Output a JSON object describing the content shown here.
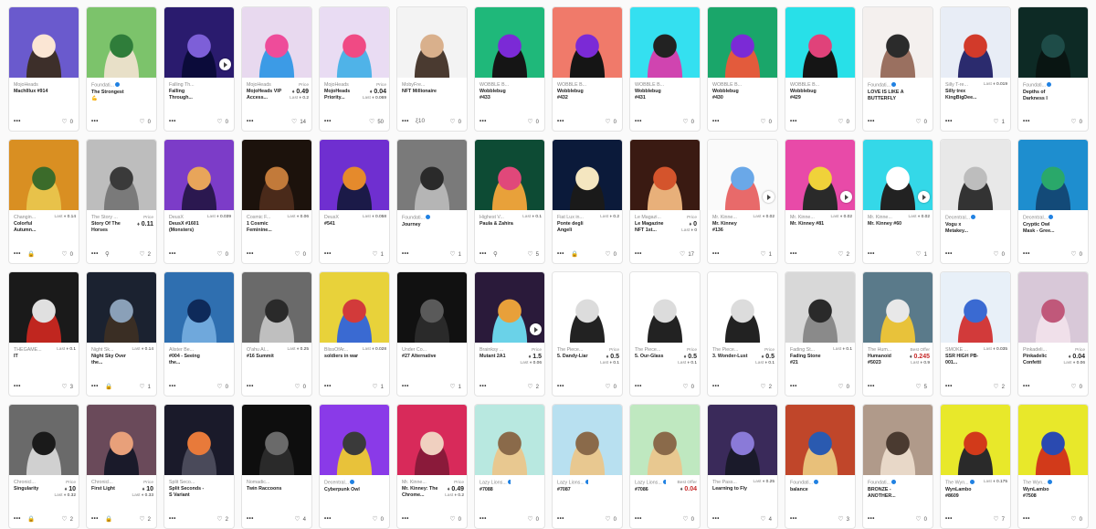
{
  "cards": [
    {
      "collection": "MojoHeads",
      "verified": false,
      "name": "MachIllux #914",
      "likes": "0",
      "footer_icon": "",
      "art": [
        "#6a5acd",
        "#fbe6d4",
        "#3d2f2a"
      ]
    },
    {
      "collection": "Foundati...",
      "verified": true,
      "name": "The Strongest 💪",
      "likes": "0",
      "footer_icon": "",
      "art": [
        "#7cc36b",
        "#2f7d3a",
        "#e8e0c8"
      ]
    },
    {
      "collection": "Falling Th...",
      "verified": false,
      "name": "Falling Through...",
      "likes": "0",
      "footer_icon": "",
      "play": true,
      "art": [
        "#2a1b6e",
        "#7d5fd8",
        "#0b0b3a"
      ]
    },
    {
      "collection": "MojoHeads",
      "verified": false,
      "name": "MojoHeads VIP Access...",
      "price_label": "Price",
      "price": "0.49",
      "last": "0.2",
      "likes": "14",
      "footer_icon": "",
      "art": [
        "#e8d9ef",
        "#ee4c9a",
        "#3c9be6"
      ]
    },
    {
      "collection": "MojoHeads",
      "verified": false,
      "name": "MojoHeads Priority...",
      "price_label": "Price",
      "price": "0.04",
      "last": "0.069",
      "likes": "50",
      "footer_icon": "",
      "art": [
        "#e9dcf3",
        "#f04a84",
        "#4fb3e8"
      ]
    },
    {
      "collection": "MobyFre...",
      "verified": false,
      "name": "NFT Millionaire",
      "likes": "0",
      "footer_icon": "ξ10",
      "art": [
        "#f3f3f3",
        "#d9b08c",
        "#4a3a30"
      ]
    },
    {
      "collection": "WOBBLE B...",
      "verified": false,
      "name": "Wobblebug #433",
      "likes": "0",
      "footer_icon": "",
      "art": [
        "#1fb87a",
        "#7b2ad6",
        "#151515"
      ]
    },
    {
      "collection": "WOBBLE B...",
      "verified": false,
      "name": "Wobblebug #432",
      "likes": "0",
      "footer_icon": "",
      "art": [
        "#f07a6a",
        "#7b2ad6",
        "#151515"
      ]
    },
    {
      "collection": "WOBBLE B...",
      "verified": false,
      "name": "Wobblebug #431",
      "likes": "0",
      "footer_icon": "",
      "art": [
        "#34e0f0",
        "#222222",
        "#d044b0"
      ]
    },
    {
      "collection": "WOBBLE B...",
      "verified": false,
      "name": "Wobblebug #430",
      "likes": "0",
      "footer_icon": "",
      "art": [
        "#1aa66a",
        "#7b2ad6",
        "#e35b3c"
      ]
    },
    {
      "collection": "WOBBLE B...",
      "verified": false,
      "name": "Wobblebug #429",
      "likes": "0",
      "footer_icon": "",
      "art": [
        "#28e0e8",
        "#e0427a",
        "#151515"
      ]
    },
    {
      "collection": "Foundati...",
      "verified": true,
      "name": "LOVE IS LIKE A BUTTERFLY",
      "likes": "0",
      "footer_icon": "",
      "art": [
        "#f4f0ee",
        "#2b2b2b",
        "#9a7060"
      ]
    },
    {
      "collection": "Silly T-re...",
      "verified": false,
      "name": "Silly trex KingBigDee...",
      "last": "0.019",
      "likes": "1",
      "footer_icon": "",
      "art": [
        "#e8edf6",
        "#d23a2a",
        "#2b2b6e"
      ]
    },
    {
      "collection": "Foundati...",
      "verified": true,
      "name": "Depths of Darkness I",
      "likes": "0",
      "footer_icon": "",
      "art": [
        "#0d2a25",
        "#1e4c48",
        "#091512"
      ]
    },
    {
      "collection": "Changin...",
      "verified": false,
      "name": "Colorful Autumn...",
      "last": "0.14",
      "likes": "0",
      "footer_icon": "🔒",
      "art": [
        "#d98f22",
        "#3b6b2a",
        "#e8c24a"
      ]
    },
    {
      "collection": "The Story ...",
      "verified": false,
      "name": "Story Of The Horses",
      "price_label": "Price",
      "price": "0.11",
      "likes": "2",
      "footer_icon": "⚲",
      "art": [
        "#bdbdbd",
        "#3a3a3a",
        "#7a7a7a"
      ]
    },
    {
      "collection": "DeusX",
      "verified": false,
      "name": "DeusX #1601 (Monsters)",
      "last": "0.039",
      "likes": "0",
      "footer_icon": "",
      "art": [
        "#7c3cc8",
        "#e8a55a",
        "#2b1850"
      ]
    },
    {
      "collection": "Cosmic F...",
      "verified": false,
      "name": "1 Cosmic Feminine...",
      "last": "0.06",
      "likes": "0",
      "footer_icon": "",
      "art": [
        "#1c120c",
        "#c27a3a",
        "#4a2a1a"
      ]
    },
    {
      "collection": "DeusX",
      "verified": false,
      "name": "#541",
      "last": "0.058",
      "likes": "1",
      "footer_icon": "",
      "art": [
        "#6f2fd0",
        "#e58a2c",
        "#1b1a48"
      ]
    },
    {
      "collection": "Foundati...",
      "verified": true,
      "name": "Journey",
      "likes": "1",
      "footer_icon": "",
      "art": [
        "#7a7a7a",
        "#2a2a2a",
        "#b5b5b5"
      ]
    },
    {
      "collection": "Highest V...",
      "verified": false,
      "name": "Paula & Zahira",
      "last": "0.1",
      "likes": "5",
      "footer_icon": "⚲",
      "art": [
        "#0d4b34",
        "#e0487a",
        "#e8a13a"
      ]
    },
    {
      "collection": "Fiat Lux in...",
      "verified": false,
      "name": "Ponte degli Angeli",
      "last": "0.2",
      "likes": "0",
      "footer_icon": "🔒",
      "art": [
        "#0b1a3a",
        "#f4e6c0",
        "#1a1a1a"
      ]
    },
    {
      "collection": "Le Magazi...",
      "verified": false,
      "name": "Le Magazine NFT 1st...",
      "price_label": "Price",
      "price": "0",
      "last": "0",
      "likes": "17",
      "footer_icon": "",
      "art": [
        "#3a1a12",
        "#d4542c",
        "#e8b07a"
      ]
    },
    {
      "collection": "Mr. Kinne...",
      "verified": false,
      "name": "Mr. Kinney #136",
      "last": "0.02",
      "likes": "1",
      "footer_icon": "",
      "play": true,
      "art": [
        "#fafafa",
        "#6aa8e8",
        "#e86a6a"
      ]
    },
    {
      "collection": "Mr. Kinne...",
      "verified": false,
      "name": "Mr. Kinney #81",
      "last": "0.02",
      "likes": "2",
      "footer_icon": "",
      "play": true,
      "art": [
        "#e84aa8",
        "#f0d23a",
        "#2a2a2a"
      ]
    },
    {
      "collection": "Mr. Kinne...",
      "verified": false,
      "name": "Mr. Kinney #60",
      "last": "0.02",
      "likes": "1",
      "footer_icon": "",
      "play": true,
      "art": [
        "#34d8e8",
        "#ffffff",
        "#222222"
      ]
    },
    {
      "collection": "Decentral...",
      "verified": true,
      "name": "Vogu x Metakey...",
      "likes": "0",
      "footer_icon": "",
      "art": [
        "#e8e8e8",
        "#bdbdbd",
        "#333333"
      ]
    },
    {
      "collection": "Decentral...",
      "verified": true,
      "name": "Cryptic Owl Mask - Gree...",
      "likes": "0",
      "footer_icon": "",
      "art": [
        "#1e8ecf",
        "#2aa86a",
        "#134a78"
      ]
    },
    {
      "collection": "THEGAME...",
      "verified": false,
      "name": "IT",
      "last": "0.1",
      "likes": "3",
      "footer_icon": "",
      "art": [
        "#1a1a1a",
        "#e0e0e0",
        "#c0261f"
      ]
    },
    {
      "collection": "Night Sk...",
      "verified": false,
      "name": "Night Sky Over the...",
      "last": "0.14",
      "likes": "1",
      "footer_icon": "🔒",
      "art": [
        "#1b2230",
        "#8aa0b8",
        "#3a2e24"
      ]
    },
    {
      "collection": "Alister Be...",
      "verified": false,
      "name": "#004 - Seeing the...",
      "likes": "0",
      "footer_icon": "",
      "art": [
        "#2f6fb0",
        "#0e2a5a",
        "#6fa8dc"
      ]
    },
    {
      "collection": "O'ahu Al...",
      "verified": false,
      "name": "#16 Summit",
      "last": "0.25",
      "likes": "0",
      "footer_icon": "",
      "art": [
        "#6a6a6a",
        "#2a2a2a",
        "#bfbfbf"
      ]
    },
    {
      "collection": "BlissOfAr...",
      "verified": false,
      "name": "soldiers in war",
      "last": "0.028",
      "likes": "1",
      "footer_icon": "",
      "art": [
        "#e8d23a",
        "#d23a3a",
        "#3a6ad2"
      ]
    },
    {
      "collection": "Under Co...",
      "verified": false,
      "name": "#27 Alternative",
      "likes": "1",
      "footer_icon": "",
      "art": [
        "#111111",
        "#5a5a5a",
        "#2a2a2a"
      ]
    },
    {
      "collection": "Brainksy ...",
      "verified": false,
      "name": "Mutant 2A1",
      "price_label": "Price",
      "price": "1.5",
      "last": "0.06",
      "likes": "2",
      "footer_icon": "",
      "play": true,
      "art": [
        "#2a1a3a",
        "#e8a03a",
        "#6ad2e8"
      ]
    },
    {
      "collection": "The Piece...",
      "verified": false,
      "name": "5. Dandy-Liar",
      "price_label": "Price",
      "price": "0.5",
      "last": "0.1",
      "likes": "0",
      "footer_icon": "",
      "art": [
        "#ffffff",
        "#dcdcdc",
        "#222222"
      ]
    },
    {
      "collection": "The Piece...",
      "verified": false,
      "name": "5. Our-Glass",
      "price_label": "Price",
      "price": "0.5",
      "last": "0.1",
      "likes": "0",
      "footer_icon": "",
      "art": [
        "#ffffff",
        "#dcdcdc",
        "#222222"
      ]
    },
    {
      "collection": "The Piece...",
      "verified": false,
      "name": "3. Wonder-Lust",
      "price_label": "Price",
      "price": "0.5",
      "last": "0.1",
      "likes": "2",
      "footer_icon": "",
      "art": [
        "#ffffff",
        "#dcdcdc",
        "#222222"
      ]
    },
    {
      "collection": "Fading St...",
      "verified": false,
      "name": "Fading Stone #21",
      "last": "0.1",
      "likes": "0",
      "footer_icon": "",
      "art": [
        "#d8d8d8",
        "#2a2a2a",
        "#8a8a8a"
      ]
    },
    {
      "collection": "The Hum...",
      "verified": false,
      "name": "Humanoid #5023",
      "price_label": "Best Offer",
      "price": "0.245",
      "price_red": true,
      "last": "0.9",
      "likes": "5",
      "footer_icon": "",
      "art": [
        "#5a7a8a",
        "#e8e8e8",
        "#e8c23a"
      ]
    },
    {
      "collection": "SMOKE ...",
      "verified": false,
      "name": "SSR HIGH PB-001...",
      "last": "0.035",
      "likes": "2",
      "footer_icon": "",
      "art": [
        "#e8f0f8",
        "#3a6ad2",
        "#d23a3a"
      ]
    },
    {
      "collection": "Pinkadeli...",
      "verified": false,
      "name": "Pinkadelic Confetti",
      "price_label": "Price",
      "price": "0.04",
      "last": "0.06",
      "likes": "0",
      "footer_icon": "",
      "art": [
        "#d8c8d8",
        "#c0587a",
        "#f0e0ea"
      ]
    },
    {
      "collection": "Chronicl...",
      "verified": false,
      "name": "Singularity",
      "price_label": "Price",
      "price": "10",
      "last": "0.32",
      "likes": "2",
      "footer_icon": "🔒",
      "art": [
        "#6a6a6a",
        "#1a1a1a",
        "#d0d0d0"
      ]
    },
    {
      "collection": "Chronicl...",
      "verified": false,
      "name": "First Light",
      "price_label": "Price",
      "price": "10",
      "last": "0.33",
      "likes": "2",
      "footer_icon": "🔒",
      "art": [
        "#6a4a5a",
        "#e8a07a",
        "#1a1a2a"
      ]
    },
    {
      "collection": "Split Seco...",
      "verified": false,
      "name": "Split Seconds - S Variant",
      "likes": "2",
      "footer_icon": "",
      "art": [
        "#1a1a2a",
        "#e87a3a",
        "#4a4a5a"
      ]
    },
    {
      "collection": "Nomadic...",
      "verified": false,
      "name": "Twin Raccoons",
      "likes": "4",
      "footer_icon": "",
      "art": [
        "#0e0e0e",
        "#6a6a6a",
        "#2a2a2a"
      ]
    },
    {
      "collection": "Decentral...",
      "verified": true,
      "name": "Cyberpunk Owl",
      "likes": "0",
      "footer_icon": "",
      "art": [
        "#8a3ae8",
        "#3a3a3a",
        "#e8c23a"
      ]
    },
    {
      "collection": "Mr. Kinne...",
      "verified": false,
      "name": "Mr. Kinney: The Chrome...",
      "price_label": "Price",
      "price": "0.49",
      "last": "0.2",
      "likes": "0",
      "footer_icon": "",
      "art": [
        "#d82a5a",
        "#f0d0c0",
        "#8a1a3a"
      ]
    },
    {
      "collection": "Lazy Lions...",
      "verified": true,
      "name": "#7088",
      "likes": "0",
      "footer_icon": "",
      "art": [
        "#b8e8e0",
        "#8a6a4a",
        "#e8c890"
      ]
    },
    {
      "collection": "Lazy Lions...",
      "verified": true,
      "name": "#7087",
      "likes": "0",
      "footer_icon": "",
      "art": [
        "#b8e0f0",
        "#8a6a4a",
        "#e8c890"
      ]
    },
    {
      "collection": "Lazy Lions...",
      "verified": true,
      "name": "#7086",
      "price_label": "Best Offer",
      "price": "0.04",
      "price_red": true,
      "likes": "0",
      "footer_icon": "",
      "art": [
        "#bfe8c0",
        "#8a6a4a",
        "#e8c890"
      ]
    },
    {
      "collection": "The Pass...",
      "verified": false,
      "name": "Learning to Fly",
      "last": "0.25",
      "likes": "4",
      "footer_icon": "",
      "art": [
        "#3a2a5a",
        "#8a7ad8",
        "#1a1a2a"
      ]
    },
    {
      "collection": "Foundati...",
      "verified": true,
      "name": "balance",
      "likes": "3",
      "footer_icon": "",
      "art": [
        "#c0462a",
        "#2a5ab0",
        "#e8c07a"
      ]
    },
    {
      "collection": "Foundati...",
      "verified": true,
      "name": "BRONZE - ANOTHER...",
      "likes": "0",
      "footer_icon": "",
      "art": [
        "#b09a8a",
        "#4a3a30",
        "#e8d8c8"
      ]
    },
    {
      "collection": "The Wyn...",
      "verified": true,
      "name": "WynLambo #8609",
      "last": "0.175",
      "likes": "7",
      "footer_icon": "",
      "art": [
        "#e8e82a",
        "#d23a1a",
        "#2a2a2a"
      ]
    },
    {
      "collection": "The Wyn...",
      "verified": true,
      "name": "WynLambo #7508",
      "likes": "0",
      "footer_icon": "",
      "art": [
        "#e8e82a",
        "#2a4ab0",
        "#d23a1a"
      ]
    }
  ],
  "labels": {
    "last": "Last",
    "more": "•••"
  }
}
